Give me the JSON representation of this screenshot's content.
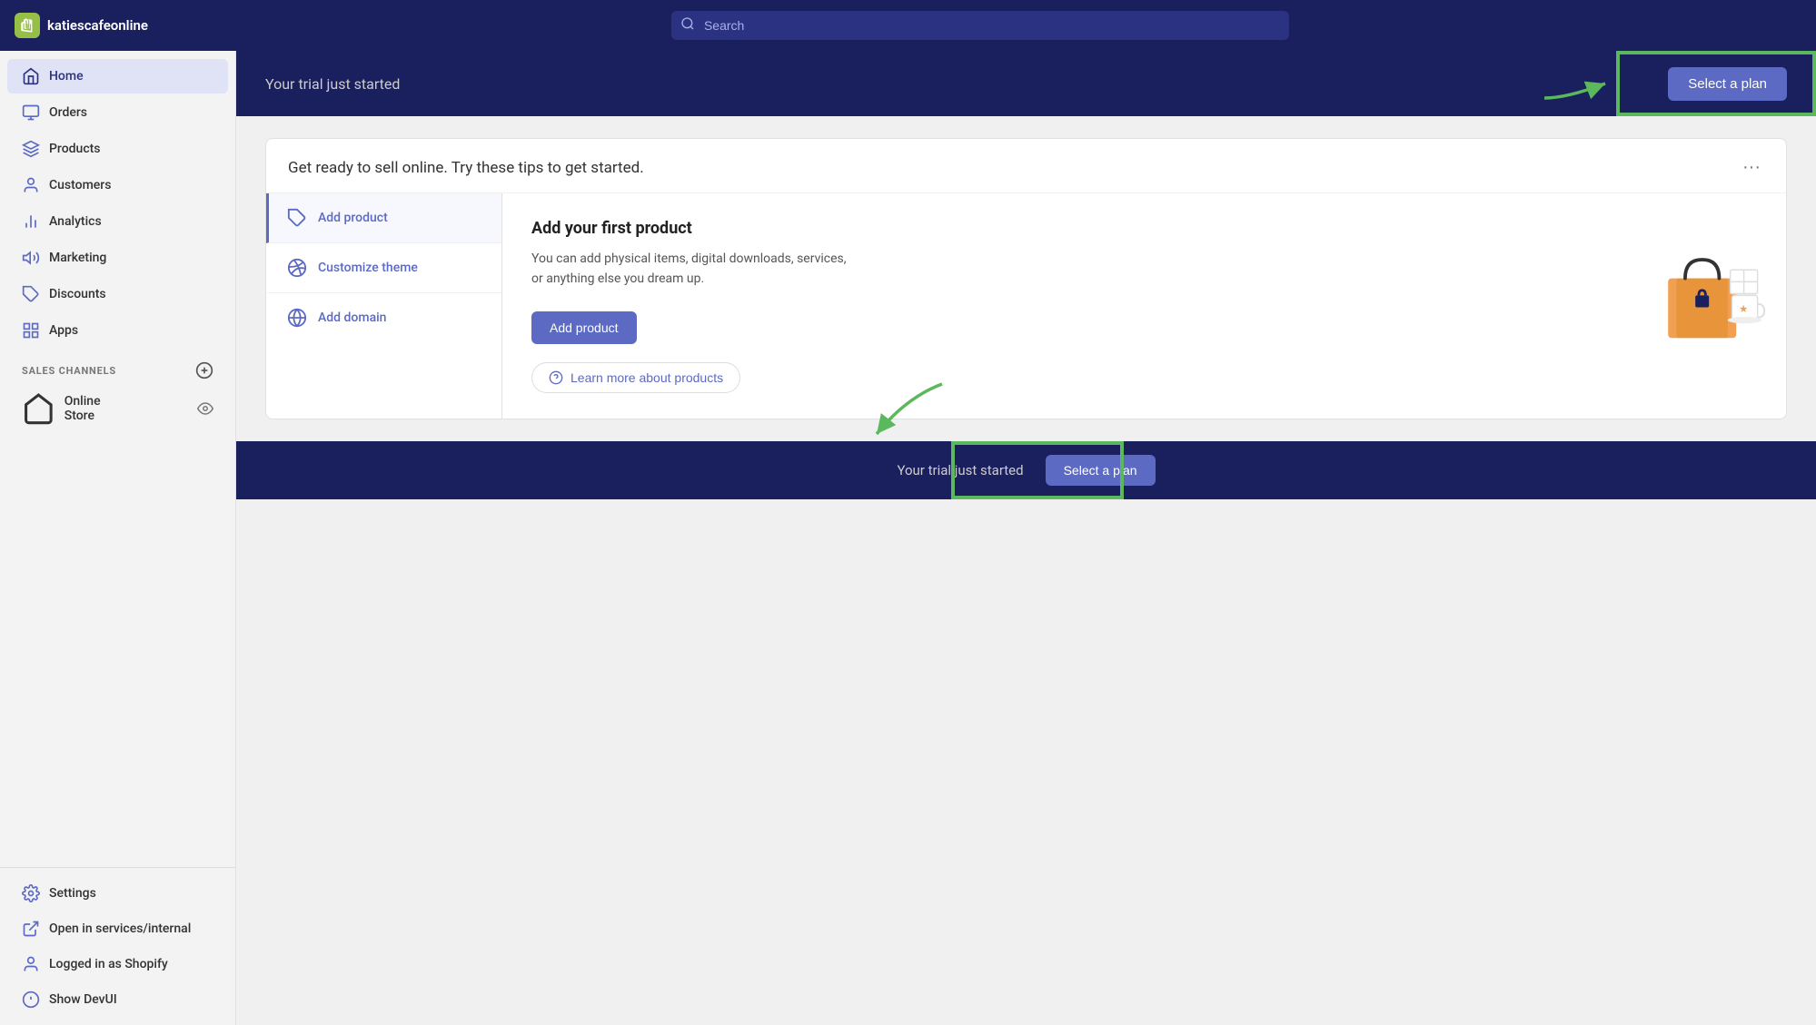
{
  "topNav": {
    "storeName": "katiescafeonline",
    "searchPlaceholder": "Search"
  },
  "sidebar": {
    "navItems": [
      {
        "id": "home",
        "label": "Home",
        "active": true
      },
      {
        "id": "orders",
        "label": "Orders"
      },
      {
        "id": "products",
        "label": "Products"
      },
      {
        "id": "customers",
        "label": "Customers"
      },
      {
        "id": "analytics",
        "label": "Analytics"
      },
      {
        "id": "marketing",
        "label": "Marketing"
      },
      {
        "id": "discounts",
        "label": "Discounts"
      },
      {
        "id": "apps",
        "label": "Apps"
      }
    ],
    "salesChannelsLabel": "SALES CHANNELS",
    "onlineStore": "Online Store",
    "bottomItems": [
      {
        "id": "settings",
        "label": "Settings"
      },
      {
        "id": "open-in-services",
        "label": "Open in services/internal"
      },
      {
        "id": "logged-in",
        "label": "Logged in as Shopify"
      },
      {
        "id": "show-devui",
        "label": "Show DevUI"
      }
    ]
  },
  "trialBanner": {
    "text": "Your trial just started",
    "buttonLabel": "Select a plan"
  },
  "tipsCard": {
    "title": "Get ready to sell online. Try these tips to get started.",
    "moreLabel": "···",
    "tips": [
      {
        "id": "add-product",
        "label": "Add product",
        "active": true
      },
      {
        "id": "customize-theme",
        "label": "Customize theme"
      },
      {
        "id": "add-domain",
        "label": "Add domain"
      }
    ],
    "detail": {
      "title": "Add your first product",
      "description": "You can add physical items, digital downloads, services, or anything else you dream up.",
      "addButtonLabel": "Add product",
      "learnMoreLabel": "Learn more about products"
    }
  },
  "bottomBanner": {
    "text": "Your trial just started",
    "buttonLabel": "Select a plan"
  }
}
